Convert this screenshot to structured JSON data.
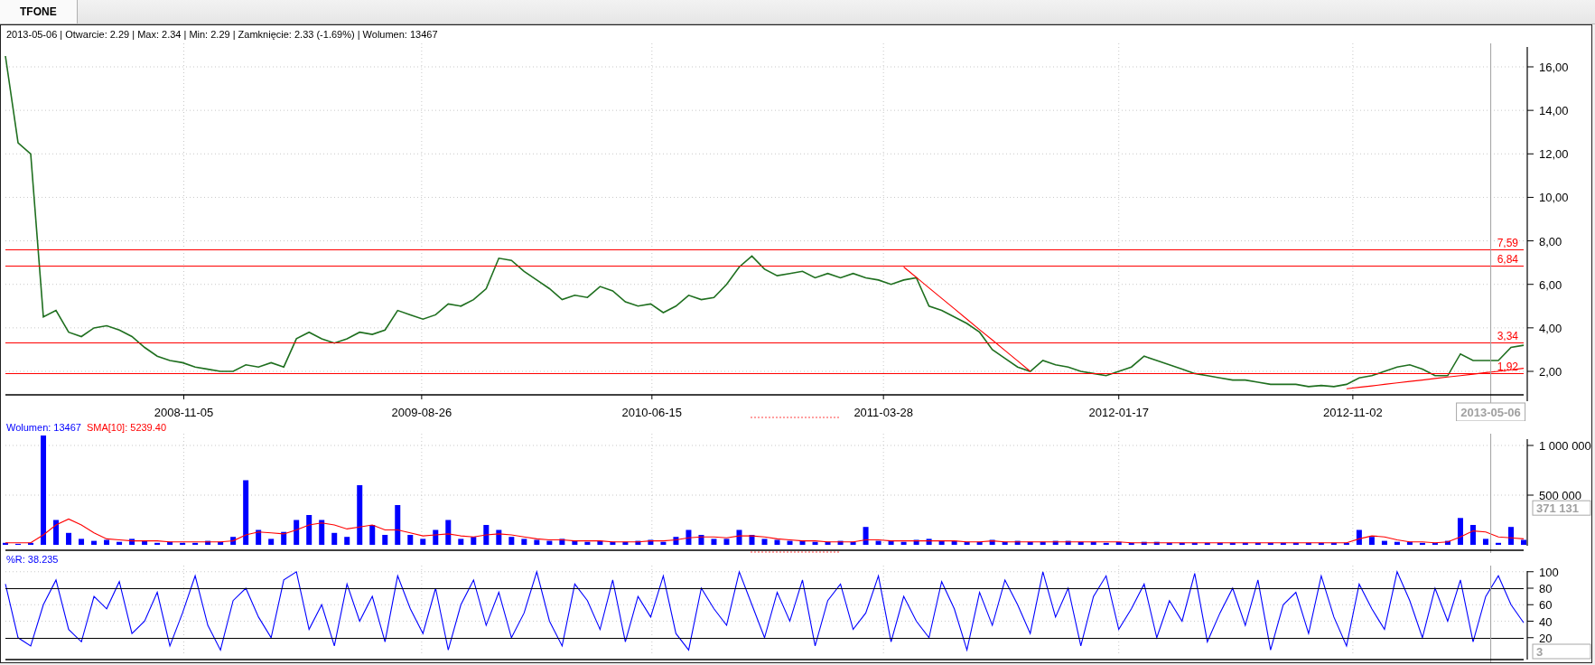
{
  "tabs": [
    {
      "label": "TFONE",
      "selected": true
    }
  ],
  "price": {
    "info": "2013-05-06 | Otwarcie: 2.29 | Max: 2.34 | Min: 2.29 | Zamknięcie: 2.33 (-1.69%)  | Wolumen: 13467",
    "x_labels": [
      "2008-11-05",
      "2009-08-26",
      "2010-06-15",
      "2011-03-28",
      "2012-01-17",
      "2012-11-02"
    ],
    "cursor_label": "2013-05-06",
    "chart_data": {
      "type": "line",
      "ylim": [
        0.92,
        17.08
      ],
      "grid": true,
      "yticks": [
        {
          "value": 2,
          "label": "2,00"
        },
        {
          "value": 4,
          "label": "4,00"
        },
        {
          "value": 6,
          "label": "6,00"
        },
        {
          "value": 8,
          "label": "8,00"
        },
        {
          "value": 10,
          "label": "10,00"
        },
        {
          "value": 12,
          "label": "12,00"
        },
        {
          "value": 14,
          "label": "14,00"
        },
        {
          "value": 16,
          "label": "16,00"
        }
      ],
      "series": [
        {
          "color": "#1f6f1f",
          "values": [
            16.5,
            12.5,
            12,
            4.5,
            4.8,
            3.8,
            3.6,
            4.0,
            4.1,
            3.9,
            3.6,
            3.1,
            2.7,
            2.5,
            2.4,
            2.2,
            2.1,
            2.0,
            2.0,
            2.3,
            2.2,
            2.4,
            2.2,
            3.5,
            3.8,
            3.5,
            3.3,
            3.5,
            3.8,
            3.7,
            3.9,
            4.8,
            4.6,
            4.4,
            4.6,
            5.1,
            5.0,
            5.3,
            5.8,
            7.2,
            7.1,
            6.6,
            6.2,
            5.8,
            5.3,
            5.5,
            5.4,
            5.9,
            5.7,
            5.2,
            5.0,
            5.1,
            4.7,
            5.0,
            5.5,
            5.3,
            5.4,
            6.0,
            6.8,
            7.3,
            6.7,
            6.4,
            6.5,
            6.6,
            6.3,
            6.5,
            6.3,
            6.5,
            6.3,
            6.2,
            6.0,
            6.2,
            6.3,
            5.0,
            4.8,
            4.5,
            4.2,
            3.8,
            3.0,
            2.6,
            2.2,
            2.0,
            2.5,
            2.3,
            2.2,
            2.0,
            1.9,
            1.8,
            2.0,
            2.2,
            2.7,
            2.5,
            2.3,
            2.1,
            1.9,
            1.8,
            1.7,
            1.6,
            1.6,
            1.5,
            1.4,
            1.4,
            1.4,
            1.3,
            1.35,
            1.3,
            1.4,
            1.7,
            1.8,
            2.0,
            2.2,
            2.3,
            2.1,
            1.8,
            1.8,
            2.8,
            2.5,
            2.5,
            2.5,
            3.1,
            3.2
          ]
        },
        {
          "color": "#ff0000",
          "values": [
            null,
            null,
            null,
            null,
            null,
            null,
            null,
            null,
            null,
            null,
            null,
            null,
            null,
            null,
            null,
            null,
            null,
            null,
            null,
            null,
            null,
            null,
            null,
            null,
            null,
            null,
            null,
            null,
            null,
            null,
            null,
            null,
            null,
            null,
            null,
            null,
            null,
            null,
            null,
            null,
            null,
            null,
            null,
            null,
            null,
            null,
            null,
            null,
            null,
            null,
            null,
            null,
            null,
            null,
            null,
            null,
            null,
            null,
            null,
            null,
            null,
            null,
            null,
            null,
            null,
            null,
            null,
            null,
            null,
            null,
            null,
            6.8,
            6.32,
            5.84,
            5.36,
            4.88,
            4.4,
            3.92,
            3.44,
            2.96,
            2.48,
            2.0,
            null,
            null,
            null,
            null,
            null,
            null,
            null,
            null,
            null,
            null,
            null,
            null,
            null,
            null,
            null,
            null,
            null,
            null,
            null,
            null,
            null,
            null,
            null,
            null,
            null,
            null,
            null,
            null,
            null,
            null,
            null,
            null,
            null,
            null,
            null,
            null,
            null
          ]
        },
        {
          "color": "#ff0000",
          "values": [
            null,
            null,
            null,
            null,
            null,
            null,
            null,
            null,
            null,
            null,
            null,
            null,
            null,
            null,
            null,
            null,
            null,
            null,
            null,
            null,
            null,
            null,
            null,
            null,
            null,
            null,
            null,
            null,
            null,
            null,
            null,
            null,
            null,
            null,
            null,
            null,
            null,
            null,
            null,
            null,
            null,
            null,
            null,
            null,
            null,
            null,
            null,
            null,
            null,
            null,
            null,
            null,
            null,
            null,
            null,
            null,
            null,
            null,
            null,
            null,
            null,
            null,
            null,
            null,
            null,
            null,
            null,
            null,
            null,
            null,
            null,
            null,
            null,
            null,
            null,
            null,
            null,
            null,
            null,
            null,
            null,
            null,
            null,
            null,
            null,
            null,
            null,
            null,
            null,
            null,
            null,
            null,
            null,
            null,
            null,
            null,
            null,
            null,
            null,
            null,
            null,
            null,
            null,
            null,
            null,
            null,
            1.2,
            1.27,
            1.33,
            1.4,
            1.47,
            1.54,
            1.6,
            1.67,
            1.74,
            1.8,
            1.87,
            1.94,
            2.0,
            2.07,
            2.14
          ]
        }
      ],
      "ref_lines": [
        {
          "axis": "y",
          "value": 7.59,
          "label": "7,59"
        },
        {
          "axis": "y",
          "value": 6.84,
          "label": "6,84"
        },
        {
          "axis": "y",
          "value": 3.34,
          "label": "3,34"
        },
        {
          "axis": "y",
          "value": 1.92,
          "label": "1,92"
        }
      ]
    }
  },
  "volume": {
    "legend": [
      {
        "text": "Wolumen: 13467",
        "color": "#0000ff"
      },
      {
        "text": "SMA[10]: 5239.40",
        "color": "#ff0000"
      }
    ],
    "cursor_label": "371 131",
    "chart_data": {
      "type": "bar",
      "ylim": [
        0,
        1118182
      ],
      "grid": true,
      "stacked": false,
      "yticks": [
        {
          "value": 500000,
          "label": "500 000"
        },
        {
          "value": 1000000,
          "label": "1 000 000"
        }
      ],
      "series": [
        {
          "color": "#0000ff",
          "values": [
            20000,
            10000,
            20000,
            1100000,
            250000,
            120000,
            60000,
            40000,
            50000,
            30000,
            60000,
            40000,
            20000,
            30000,
            20000,
            20000,
            40000,
            30000,
            80000,
            650000,
            150000,
            60000,
            130000,
            250000,
            300000,
            250000,
            120000,
            80000,
            600000,
            200000,
            100000,
            400000,
            100000,
            60000,
            150000,
            250000,
            60000,
            80000,
            200000,
            150000,
            80000,
            60000,
            50000,
            40000,
            60000,
            40000,
            30000,
            40000,
            30000,
            30000,
            40000,
            50000,
            30000,
            80000,
            150000,
            100000,
            60000,
            60000,
            150000,
            100000,
            60000,
            50000,
            40000,
            40000,
            30000,
            30000,
            40000,
            30000,
            180000,
            40000,
            40000,
            30000,
            50000,
            60000,
            40000,
            40000,
            30000,
            30000,
            50000,
            30000,
            40000,
            30000,
            30000,
            40000,
            40000,
            30000,
            30000,
            20000,
            30000,
            20000,
            30000,
            30000,
            20000,
            20000,
            20000,
            20000,
            20000,
            20000,
            20000,
            20000,
            20000,
            20000,
            20000,
            20000,
            20000,
            20000,
            20000,
            150000,
            80000,
            40000,
            30000,
            30000,
            20000,
            20000,
            40000,
            270000,
            200000,
            60000,
            20000,
            180000,
            50000
          ]
        },
        {
          "type": "line",
          "color": "#ff0000",
          "values": [
            20000,
            20000,
            20000,
            100000,
            200000,
            260000,
            200000,
            120000,
            60000,
            50000,
            40000,
            40000,
            40000,
            30000,
            30000,
            30000,
            30000,
            30000,
            40000,
            100000,
            130000,
            120000,
            110000,
            150000,
            200000,
            220000,
            200000,
            160000,
            180000,
            200000,
            150000,
            150000,
            120000,
            90000,
            100000,
            110000,
            90000,
            80000,
            100000,
            110000,
            100000,
            80000,
            60000,
            50000,
            50000,
            40000,
            40000,
            40000,
            30000,
            30000,
            30000,
            40000,
            40000,
            50000,
            70000,
            80000,
            80000,
            70000,
            90000,
            90000,
            80000,
            60000,
            50000,
            40000,
            40000,
            30000,
            30000,
            30000,
            50000,
            50000,
            40000,
            40000,
            40000,
            40000,
            40000,
            40000,
            30000,
            30000,
            40000,
            30000,
            30000,
            30000,
            30000,
            30000,
            30000,
            30000,
            30000,
            30000,
            30000,
            20000,
            20000,
            20000,
            20000,
            20000,
            20000,
            20000,
            20000,
            20000,
            20000,
            20000,
            20000,
            20000,
            20000,
            20000,
            20000,
            20000,
            20000,
            60000,
            90000,
            80000,
            50000,
            30000,
            30000,
            20000,
            30000,
            80000,
            140000,
            130000,
            80000,
            70000,
            60000
          ]
        }
      ]
    }
  },
  "oscillator": {
    "legend": [
      {
        "text": "%R: 38.235",
        "color": "#0000ff"
      }
    ],
    "cursor_label": "3",
    "chart_data": {
      "type": "line",
      "ylim": [
        0,
        107.4
      ],
      "grid": true,
      "yticks": [
        {
          "value": 20,
          "label": "20"
        },
        {
          "value": 40,
          "label": "40"
        },
        {
          "value": 60,
          "label": "60"
        },
        {
          "value": 80,
          "label": "80"
        },
        {
          "value": 100,
          "label": "100"
        }
      ],
      "series": [
        {
          "color": "#0000ff",
          "values": [
            85,
            20,
            10,
            60,
            90,
            30,
            15,
            70,
            55,
            88,
            25,
            40,
            75,
            10,
            50,
            95,
            35,
            5,
            65,
            80,
            45,
            20,
            90,
            100,
            30,
            60,
            10,
            85,
            40,
            70,
            15,
            95,
            55,
            25,
            80,
            5,
            60,
            90,
            35,
            75,
            20,
            50,
            100,
            40,
            10,
            85,
            65,
            30,
            90,
            15,
            70,
            45,
            95,
            25,
            5,
            80,
            55,
            35,
            100,
            60,
            20,
            75,
            40,
            90,
            10,
            65,
            85,
            30,
            50,
            95,
            15,
            70,
            40,
            20,
            88,
            55,
            5,
            75,
            35,
            90,
            60,
            25,
            100,
            45,
            80,
            10,
            70,
            95,
            30,
            55,
            85,
            20,
            65,
            40,
            98,
            15,
            50,
            80,
            35,
            90,
            5,
            60,
            75,
            25,
            95,
            45,
            10,
            85,
            55,
            30,
            100,
            65,
            20,
            80,
            40,
            90,
            15,
            70,
            95,
            60,
            38
          ]
        }
      ]
    }
  }
}
